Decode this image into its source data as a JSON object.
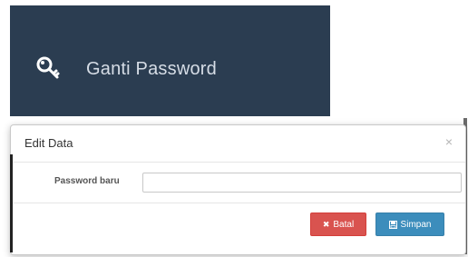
{
  "menu": {
    "item_label": "Ganti Password",
    "item_icon": "key-icon",
    "panel_color": "#2b3d51"
  },
  "modal": {
    "title": "Edit Data",
    "close_glyph": "×",
    "field_label": "Password baru",
    "field_value": "",
    "cancel": {
      "label": "Batal",
      "icon": "times-icon",
      "color": "#d9534f"
    },
    "save": {
      "label": "Simpan",
      "icon": "floppy-disk-icon",
      "color": "#3c8dbc"
    }
  }
}
